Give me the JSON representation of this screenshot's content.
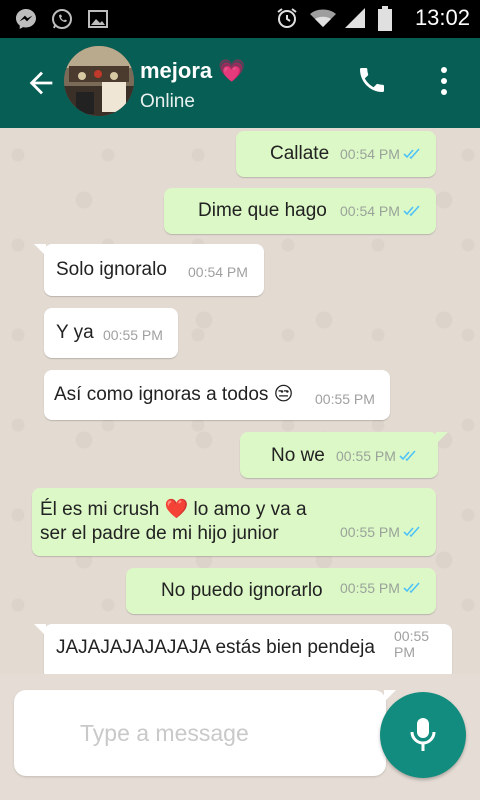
{
  "status_bar": {
    "time": "13:02",
    "left_icons": [
      "messenger-icon",
      "whatsapp-icon",
      "gallery-icon"
    ],
    "right_icons": [
      "alarm-icon",
      "wifi-icon",
      "signal-icon",
      "battery-icon"
    ]
  },
  "header": {
    "contact_name": "mejora",
    "contact_emoji": "💗",
    "status": "Online",
    "icons": [
      "back-arrow-icon",
      "call-icon",
      "more-vert-icon"
    ]
  },
  "messages": [
    {
      "dir": "out",
      "text": "Callate",
      "time": "00:54 PM",
      "ticks": "read"
    },
    {
      "dir": "out",
      "text": "Dime que hago",
      "time": "00:54 PM",
      "ticks": "read"
    },
    {
      "dir": "in",
      "text": "Solo ignoralo",
      "time": "00:54 PM"
    },
    {
      "dir": "in",
      "text": "Y ya",
      "time": "00:55 PM"
    },
    {
      "dir": "in",
      "text": "Así como ignoras a todos 😒",
      "time": "00:55 PM"
    },
    {
      "dir": "out",
      "text": "No we",
      "time": "00:55 PM",
      "ticks": "read"
    },
    {
      "dir": "out",
      "text_line1": "Él es mi crush ❤️ lo amo y va a",
      "text_line2": "ser el padre de mi hijo junior",
      "time": "00:55 PM",
      "ticks": "read"
    },
    {
      "dir": "out",
      "text": "No puedo ignorarlo",
      "time": "00:55 PM",
      "ticks": "read"
    },
    {
      "dir": "in",
      "text": "JAJAJAJAJAJAJA estás bien pendeja",
      "time_line1": "00:55",
      "time_line2": "PM"
    }
  ],
  "composer": {
    "placeholder": "Type a message",
    "mic_icon": "mic-icon"
  },
  "colors": {
    "header_green": "#075e54",
    "outgoing_bubble": "#dcf8c6",
    "incoming_bubble": "#ffffff",
    "chat_background": "#e5ddd5",
    "mic_button": "#128c7e",
    "read_ticks": "#4fc3f7"
  }
}
